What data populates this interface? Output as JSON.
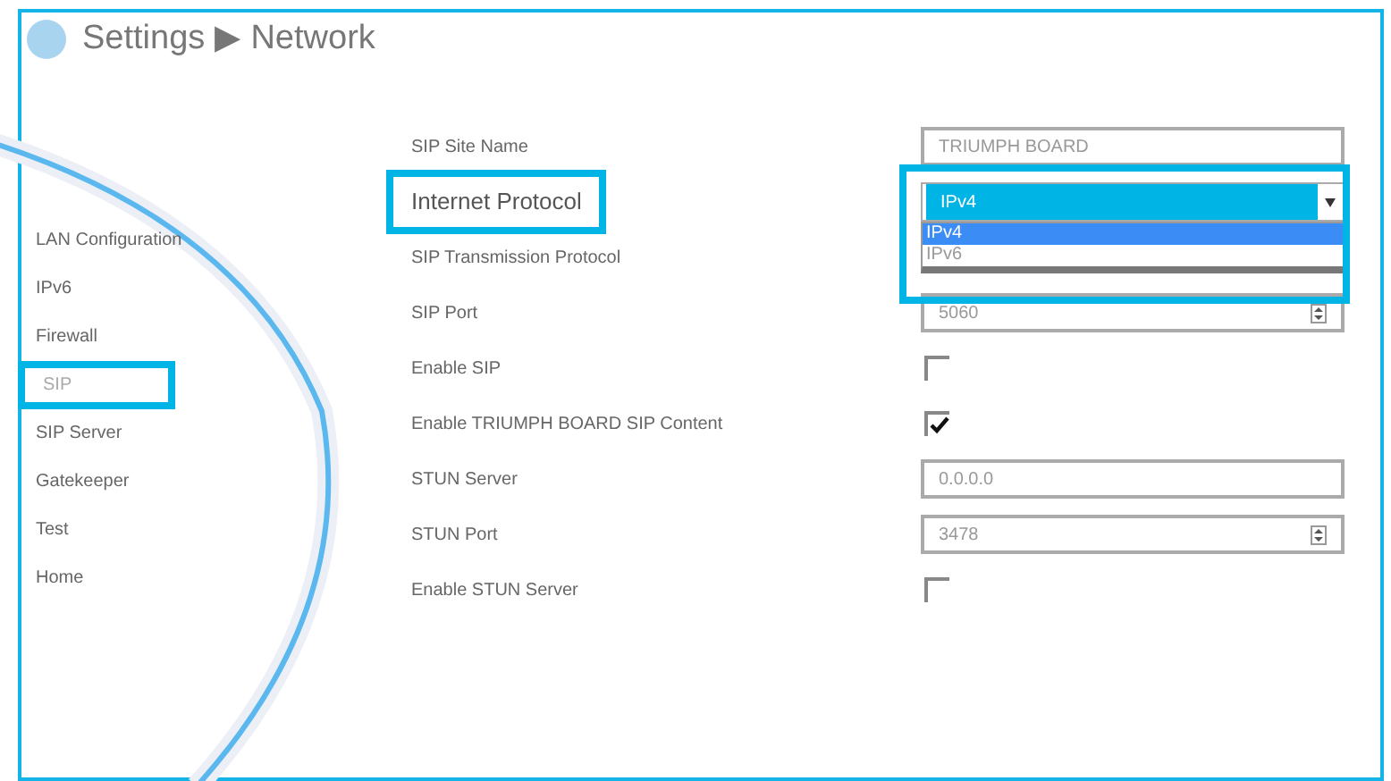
{
  "header": {
    "title": "Settings ▶ Network"
  },
  "sidebar": {
    "items": [
      {
        "label": "LAN Configuration",
        "selected": false
      },
      {
        "label": "IPv6",
        "selected": false
      },
      {
        "label": "Firewall",
        "selected": false
      },
      {
        "label": "SIP",
        "selected": true
      },
      {
        "label": "SIP Server",
        "selected": false
      },
      {
        "label": "Gatekeeper",
        "selected": false
      },
      {
        "label": "Test",
        "selected": false
      },
      {
        "label": "Home",
        "selected": false
      }
    ]
  },
  "settings": [
    {
      "label": "SIP Site Name",
      "kind": "text",
      "value": "TRIUMPH BOARD",
      "highlighted": false
    },
    {
      "label": "Internet Protocol",
      "kind": "select",
      "value": "IPv4",
      "highlighted": true,
      "expanded": true,
      "options": [
        {
          "label": "IPv4",
          "selected": true
        },
        {
          "label": "IPv6",
          "selected": false
        }
      ]
    },
    {
      "label": "SIP Transmission Protocol",
      "kind": "covered",
      "highlighted": false
    },
    {
      "label": "SIP Port",
      "kind": "number",
      "value": "5060",
      "highlighted": false
    },
    {
      "label": "Enable SIP",
      "kind": "checkbox",
      "checked": false,
      "highlighted": false
    },
    {
      "label": "Enable TRIUMPH BOARD SIP Content",
      "kind": "checkbox",
      "checked": true,
      "highlighted": false
    },
    {
      "label": "STUN Server",
      "kind": "text",
      "value": "0.0.0.0",
      "highlighted": false
    },
    {
      "label": "STUN Port",
      "kind": "number",
      "value": "3478",
      "highlighted": false
    },
    {
      "label": "Enable STUN Server",
      "kind": "checkbox",
      "checked": false,
      "highlighted": false
    }
  ]
}
